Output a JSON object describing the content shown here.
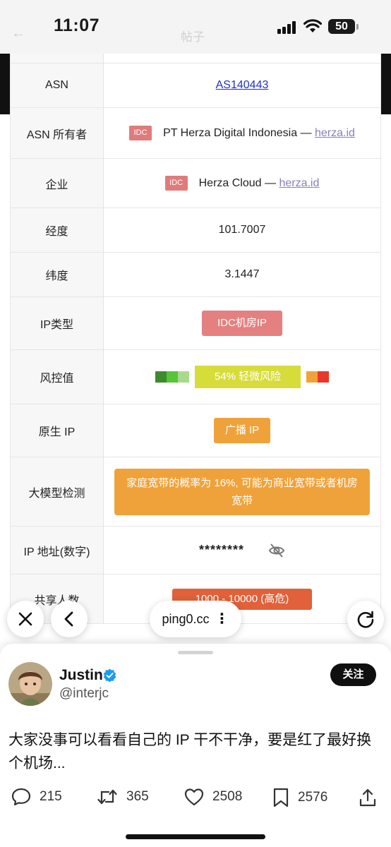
{
  "status_bar": {
    "time": "11:07",
    "battery": "50",
    "ghost_back": "←",
    "ghost_title": "帖子"
  },
  "ip_table": {
    "asn_label": "ASN",
    "asn_value": "AS140443",
    "owner_label": "ASN 所有者",
    "owner_badge": "IDC",
    "owner_name": "PT Herza Digital Indonesia —",
    "owner_link": "herza.id",
    "company_label": "企业",
    "company_badge": "IDC",
    "company_name": "Herza Cloud —",
    "company_link": "herza.id",
    "longitude_label": "经度",
    "longitude_value": "101.7007",
    "latitude_label": "纬度",
    "latitude_value": "3.1447",
    "ip_type_label": "IP类型",
    "ip_type_value": "IDC机房IP",
    "risk_label": "风控值",
    "risk_text": "54%   轻微风险",
    "risk_percent": 54,
    "native_label": "原生 IP",
    "native_value": "广播 IP",
    "model_label": "大模型检测",
    "model_value": "家庭宽带的概率为 16%, 可能为商业宽带或者机房宽带",
    "ip_numeric_label": "IP 地址(数字)",
    "ip_numeric_value": "********",
    "shared_label": "共享人数",
    "shared_value": "1000 - 10000 (高危)"
  },
  "risk_colors": {
    "green_dark": "#3e8a2e",
    "green_mid": "#58c43a",
    "green_light": "#a9d98a",
    "yellow": "#d6dc3a",
    "orange": "#f0a23a",
    "red": "#e8382b"
  },
  "browser": {
    "url": "ping0.cc",
    "close_icon": "close-icon",
    "back_icon": "chevron-left-icon",
    "reload_icon": "reload-icon"
  },
  "post": {
    "name": "Justin",
    "handle": "@interjc",
    "follow_label": "关注",
    "text": "大家没事可以看看自己的 IP 干不干净，要是红了最好换个机场...",
    "replies": "215",
    "reposts": "365",
    "likes": "2508",
    "bookmarks": "2576"
  }
}
